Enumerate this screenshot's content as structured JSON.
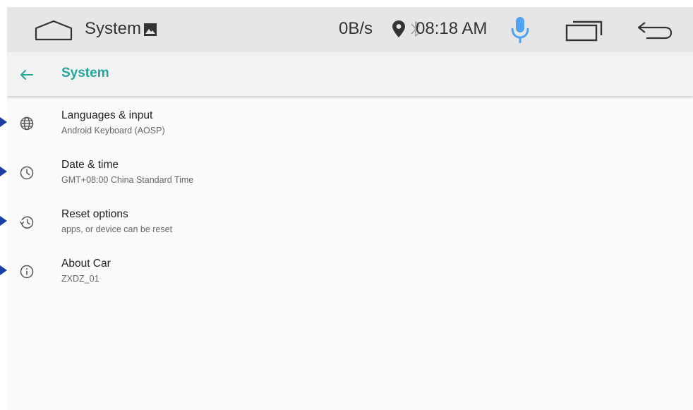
{
  "status_bar": {
    "app_title": "System",
    "net_speed": "0B/s",
    "time": "08:18 AM"
  },
  "header": {
    "title": "System"
  },
  "settings": [
    {
      "title": "Languages & input",
      "subtitle": "Android Keyboard (AOSP)",
      "icon": "globe-icon"
    },
    {
      "title": "Date & time",
      "subtitle": "GMT+08:00 China Standard Time",
      "icon": "clock-icon"
    },
    {
      "title": "Reset options",
      "subtitle": "apps, or device can be reset",
      "icon": "history-icon"
    },
    {
      "title": "About Car",
      "subtitle": "ZXDZ_01",
      "icon": "info-icon"
    }
  ],
  "colors": {
    "accent": "#26a69a",
    "mic": "#4fa3f0",
    "marker": "#1a3fa6"
  }
}
